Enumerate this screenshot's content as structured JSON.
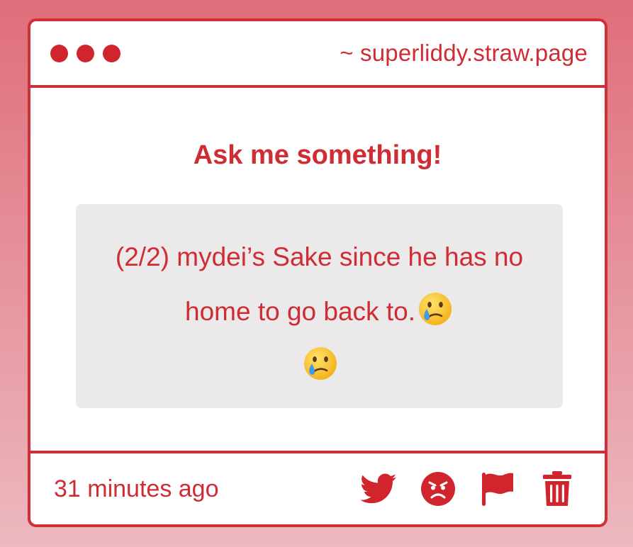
{
  "titlebar": {
    "url": "~ superliddy.straw.page"
  },
  "main": {
    "heading": "Ask me something!",
    "question_text": "(2/2) mydei’s Sake since he has no home to go back to.",
    "emoji_after_text": "crying-face-emoji",
    "emoji_trailing": "crying-face-emoji"
  },
  "footer": {
    "timestamp": "31 minutes ago",
    "actions": [
      "twitter-share-icon",
      "angry-face-icon",
      "flag-icon",
      "trash-icon"
    ]
  },
  "colors": {
    "accent": "#cf2c33",
    "box_bg": "#ebe9ea",
    "background_top": "#df6e7a",
    "background_bottom": "#edb8bf"
  }
}
